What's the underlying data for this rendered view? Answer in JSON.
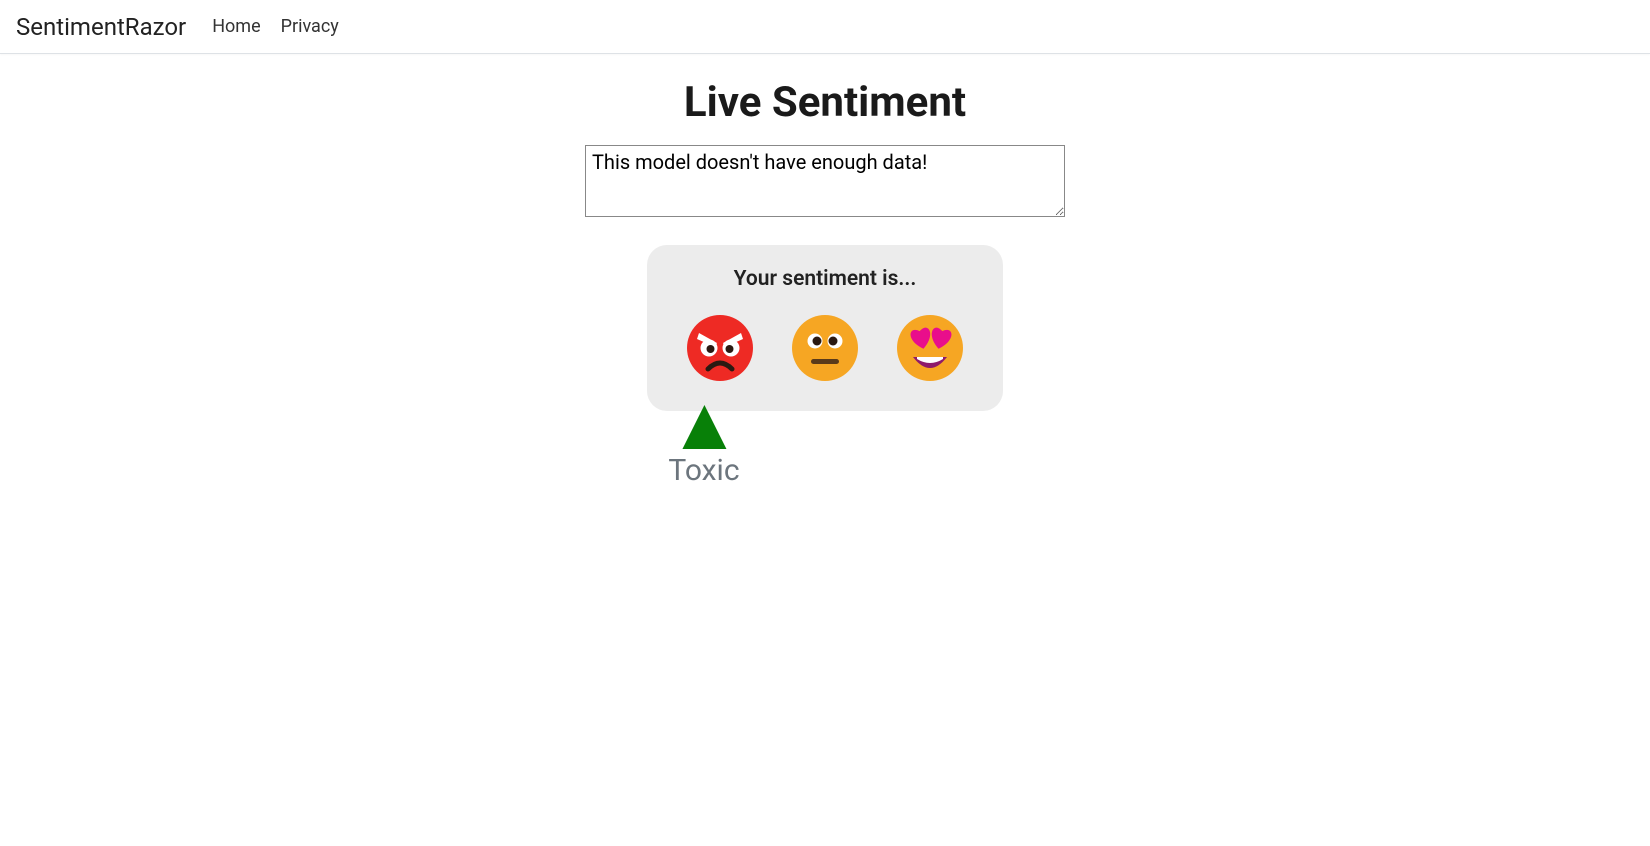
{
  "nav": {
    "brand": "SentimentRazor",
    "items": [
      {
        "label": "Home"
      },
      {
        "label": "Privacy"
      }
    ]
  },
  "main": {
    "title": "Live Sentiment",
    "input_value": "This model doesn't have enough data!",
    "result_title": "Your sentiment is...",
    "emojis": [
      {
        "name": "angry-face-icon"
      },
      {
        "name": "neutral-face-icon"
      },
      {
        "name": "heart-eyes-face-icon"
      }
    ],
    "marker": {
      "label": "Toxic",
      "position_percent": 16
    },
    "colors": {
      "card_bg": "#ececec",
      "triangle": "#088008",
      "label": "#6c757d"
    }
  }
}
